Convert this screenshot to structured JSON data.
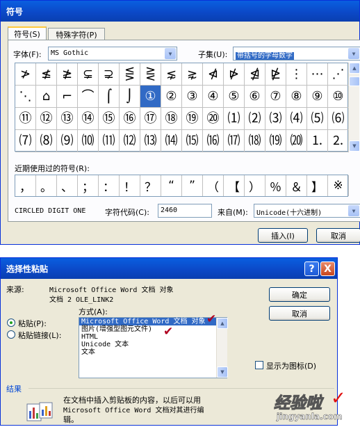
{
  "symbol_dialog": {
    "title": "符号",
    "tabs": [
      "符号(S)",
      "特殊字符(P)"
    ],
    "font_label": "字体(F):",
    "font_value": "MS Gothic",
    "subset_label": "子集(U):",
    "subset_value": "带括号的字母数字",
    "symbols": [
      [
        "≯",
        "≰",
        "≱",
        "⊊",
        "⊋",
        "⋚",
        "⋛",
        "⋦",
        "⋧",
        "⋪",
        "⋫",
        "⋬",
        "⋭",
        "⋮",
        "⋯",
        "⋰"
      ],
      [
        "⋱",
        "⌂",
        "⌐",
        "⌒",
        "⌠",
        "⌡",
        "①",
        "②",
        "③",
        "④",
        "⑤",
        "⑥",
        "⑦",
        "⑧",
        "⑨",
        "⑩"
      ],
      [
        "⑪",
        "⑫",
        "⑬",
        "⑭",
        "⑮",
        "⑯",
        "⑰",
        "⑱",
        "⑲",
        "⑳",
        "⑴",
        "⑵",
        "⑶",
        "⑷",
        "⑸",
        "⑹"
      ],
      [
        "⑺",
        "⑻",
        "⑼",
        "⑽",
        "⑾",
        "⑿",
        "⒀",
        "⒁",
        "⒂",
        "⒃",
        "⒄",
        "⒅",
        "⒆",
        "⒇",
        "⒈",
        "⒉"
      ]
    ],
    "recent_label": "近期使用过的符号(R):",
    "recent_symbols": [
      "，",
      "。",
      "、",
      "；",
      "：",
      "！",
      "？",
      "“",
      "”",
      "（",
      "【",
      "）",
      "％",
      "＆",
      "】",
      "※"
    ],
    "char_name": "CIRCLED DIGIT ONE",
    "code_label": "字符代码(C):",
    "code_value": "2460",
    "from_label": "来自(M):",
    "from_value": "Unicode(十六进制)",
    "insert_button": "插入(I)",
    "cancel_button": "取消"
  },
  "paste_dialog": {
    "title": "选择性粘贴",
    "help_glyph": "?",
    "close_glyph": "X",
    "source_label": "来源:",
    "source_line1": "Microsoft Office Word 文档 对象",
    "source_line2": "文档 2 OLE_LINK2",
    "as_label": "方式(A):",
    "paste_radio": "粘贴(P):",
    "paste_link_radio": "粘贴链接(L):",
    "formats": [
      "Microsoft Office Word 文档 对象",
      "图片(增强型图元文件)",
      "HTML",
      "Unicode 文本",
      "文本"
    ],
    "ok_button": "确定",
    "cancel_button": "取消",
    "show_as_icon": "显示为图标(D)",
    "result_label": "结果",
    "result_text_1": "在文档中插入剪贴板的内容，以后可以用",
    "result_text_2": "Microsoft Office Word 文档对其进行编",
    "result_text_3": "辑。"
  },
  "watermark": {
    "text": "经验啦",
    "url": "jingyanla.com"
  }
}
